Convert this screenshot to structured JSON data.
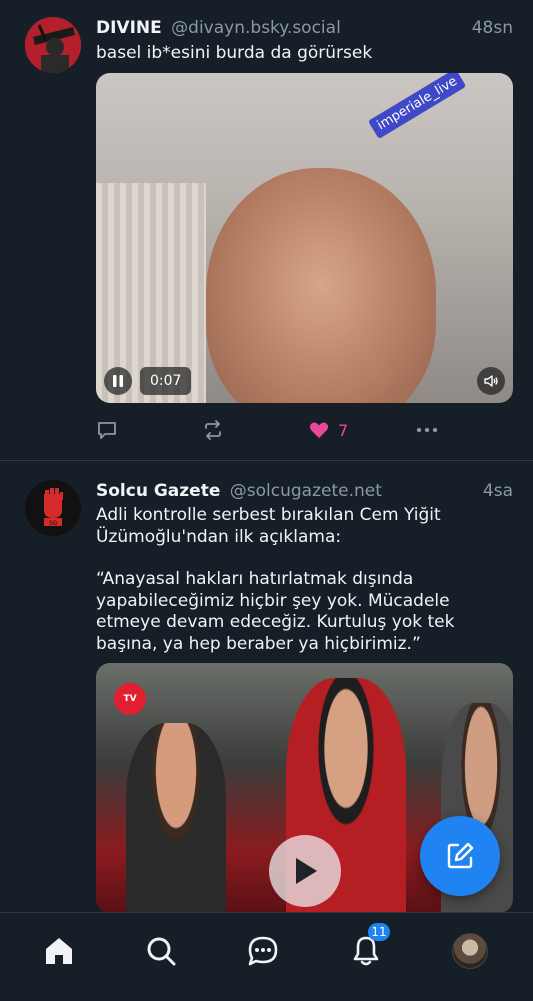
{
  "posts": [
    {
      "author_name": "DIVINE",
      "author_handle": "@divayn.bsky.social",
      "time": "48sn",
      "text": "basel ib*esini burda da görürsek",
      "video": {
        "duration": "0:07",
        "watermark": "imperiale_live",
        "playing": true
      },
      "likes": "7",
      "liked": true
    },
    {
      "author_name": "Solcu Gazete",
      "author_handle": "@solcugazete.net",
      "time": "4sa",
      "text_p1": "Adli kontrolle serbest bırakılan Cem Yiğit Üzümoğlu'ndan ilk açıklama:",
      "text_p2": "“Anayasal hakları hatırlatmak dışında yapabileceğimiz hiçbir şey yok. Mücadele etmeye devam edeceğiz. Kurtuluş yok tek başına, ya hep beraber ya hiçbirimiz.”",
      "video": {
        "tv_logo": "TV",
        "playing": false
      }
    }
  ],
  "tabbar": {
    "notifications_count": "11"
  },
  "colors": {
    "background": "#161e27",
    "accent": "#1f83f2",
    "like": "#ec4899",
    "muted": "#8a98a8"
  }
}
